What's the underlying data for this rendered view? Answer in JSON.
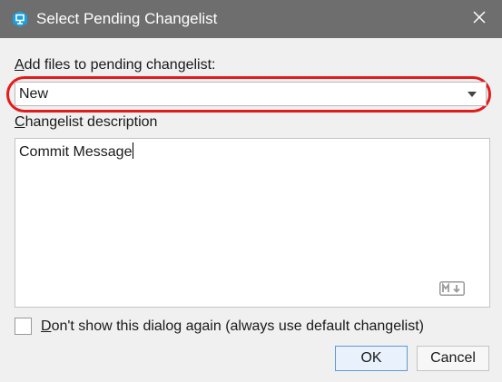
{
  "window": {
    "title": "Select Pending Changelist",
    "app_icon": "perforce-changelist-icon",
    "close_icon": "close-icon"
  },
  "changelist": {
    "label": "Add files to pending changelist:",
    "selected": "New"
  },
  "description": {
    "label": "Changelist description",
    "value": "Commit Message",
    "markdown_icon": "markdown-icon"
  },
  "dont_show": {
    "label": "Don't show this dialog again (always use default changelist)",
    "checked": false
  },
  "buttons": {
    "ok": "OK",
    "cancel": "Cancel"
  },
  "colors": {
    "titlebar": "#6e6e6e",
    "highlight": "#e31b1b",
    "ok_border": "#5b9bd5"
  }
}
